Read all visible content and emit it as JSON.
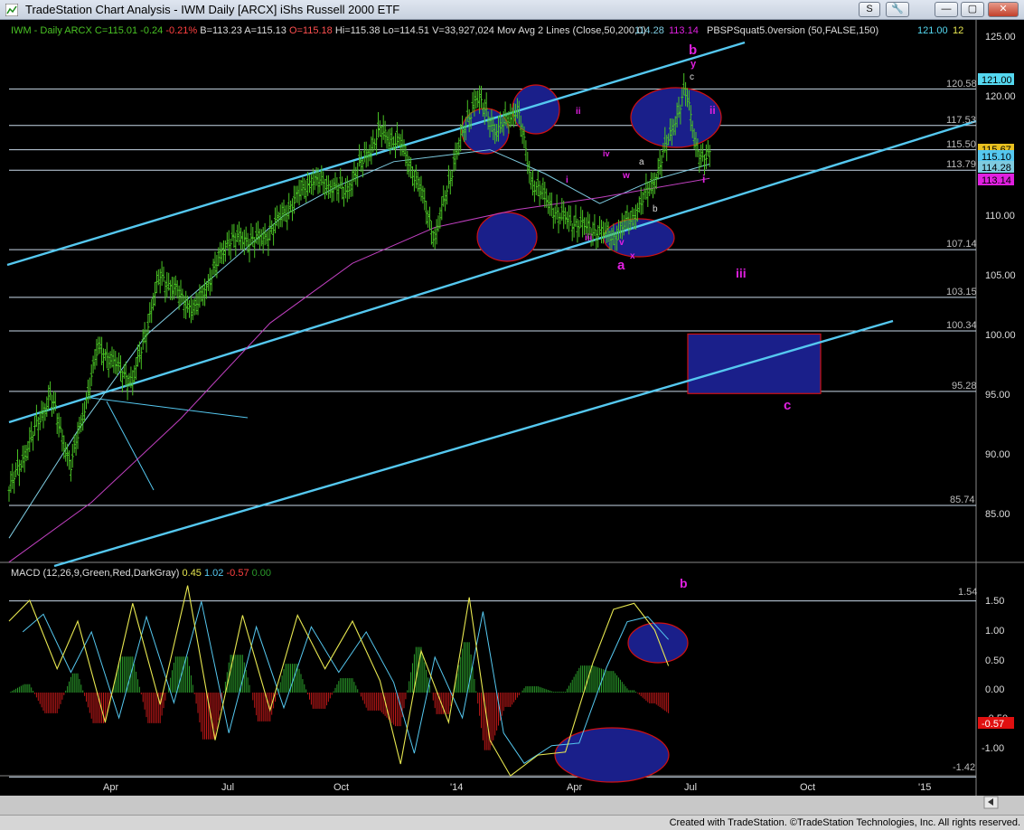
{
  "window": {
    "title": "TradeStation Chart Analysis - IWM Daily [ARCX] iShs Russell 2000 ETF",
    "buttons": [
      "S",
      "🔧",
      "—",
      "▢",
      "✕"
    ]
  },
  "footer": "Created with TradeStation. ©TradeStation Technologies, Inc. All rights reserved.",
  "colors": {
    "background": "#000000",
    "price_bars": "#49c224",
    "channel": "#55c8f0",
    "ma50": "#7ecbe0",
    "ma200": "#c040c0",
    "label_magenta": "#e020e0",
    "highlight": "#1a1f8a",
    "outline": "#d01010",
    "macd_line": "#e8e850",
    "signal_line": "#55c8f0",
    "hist_pos": "#2a9a2a",
    "hist_neg": "#c01818"
  },
  "price_panel": {
    "header": {
      "symbol": "IWM - Daily",
      "exchange": "ARCX",
      "last": "C=115.01",
      "change": "-0.24",
      "pct": "-0.21%",
      "bid": "B=113.23",
      "ask": "A=115.13",
      "open": "O=115.18",
      "high": "Hi=115.38",
      "low": "Lo=114.51",
      "volume": "V=33,927,024",
      "study1": "Mov Avg 2 Lines (Close,50,200,0)",
      "study1_v1": "114.28",
      "study1_v2": "113.14",
      "study2": "PBSPSquat5.0version (50,FALSE,150)",
      "study2_v1": "121.00",
      "study2_v2": "12"
    },
    "axis_labels": [
      "125.00",
      "120.00",
      "110.00",
      "105.00",
      "100.00",
      "95.00",
      "90.00",
      "85.00"
    ],
    "hlines": [
      "120.58",
      "117.53",
      "115.50",
      "113.79",
      "107.14",
      "103.15",
      "100.34",
      "95.28",
      "85.74"
    ],
    "value_tags": [
      {
        "text": "121.00",
        "bg": "#55d8f0",
        "fg": "#000"
      },
      {
        "text": "115.67",
        "bg": "#e8c020",
        "fg": "#000"
      },
      {
        "text": "115.10",
        "bg": "#55c8f0",
        "fg": "#000"
      },
      {
        "text": "114.28",
        "bg": "#7ecbe0",
        "fg": "#000"
      },
      {
        "text": "113.14",
        "bg": "#e020e0",
        "fg": "#000"
      }
    ],
    "wave_labels": [
      "b",
      "y",
      "c",
      "ii",
      "ii",
      "i",
      "iv",
      "w",
      "a",
      "b",
      "iii",
      "v",
      "x",
      "a",
      "i",
      "iii",
      "c"
    ]
  },
  "macd_panel": {
    "header": {
      "name": "MACD (12,26,9,Green,Red,DarkGray)",
      "v1": "0.45",
      "v2": "1.02",
      "v3": "-0.57",
      "v4": "0.00"
    },
    "axis_labels": [
      "1.50",
      "1.00",
      "0.50",
      "0.00",
      "-0.50",
      "-1.00"
    ],
    "hlines": [
      "1.54",
      "-1.42"
    ],
    "value_tag": "-0.57",
    "wave_label": "b"
  },
  "x_axis": [
    "Apr",
    "Jul",
    "Oct",
    "'14",
    "Apr",
    "Jul",
    "Oct",
    "'15"
  ],
  "chart_data": {
    "type": "ohlc",
    "symbol": "IWM",
    "interval": "daily",
    "ylim": [
      80,
      126
    ],
    "price_path": [
      [
        0,
        87
      ],
      [
        6,
        95
      ],
      [
        9,
        89
      ],
      [
        13,
        99
      ],
      [
        18,
        96
      ],
      [
        22,
        105
      ],
      [
        27,
        102
      ],
      [
        32,
        108
      ],
      [
        37,
        108
      ],
      [
        44,
        113
      ],
      [
        49,
        112
      ],
      [
        54,
        117
      ],
      [
        57,
        116
      ],
      [
        60,
        112
      ],
      [
        62,
        108
      ],
      [
        65,
        115
      ],
      [
        68,
        120
      ],
      [
        71,
        117
      ],
      [
        74,
        119
      ],
      [
        76,
        113
      ],
      [
        80,
        110
      ],
      [
        84,
        109
      ],
      [
        88,
        108.2
      ],
      [
        91,
        110
      ],
      [
        94,
        113
      ],
      [
        97,
        118
      ],
      [
        98.5,
        120.5
      ],
      [
        100,
        116
      ],
      [
        101,
        114.5
      ],
      [
        102,
        115
      ]
    ],
    "ma50_path": [
      [
        0,
        83
      ],
      [
        10,
        92
      ],
      [
        20,
        100
      ],
      [
        30,
        105
      ],
      [
        40,
        110
      ],
      [
        48,
        112.5
      ],
      [
        56,
        114.5
      ],
      [
        63,
        115
      ],
      [
        70,
        115.5
      ],
      [
        78,
        113.5
      ],
      [
        86,
        111
      ],
      [
        94,
        113
      ],
      [
        102,
        114.3
      ]
    ],
    "ma200_path": [
      [
        0,
        81
      ],
      [
        12,
        86
      ],
      [
        25,
        93
      ],
      [
        38,
        101
      ],
      [
        50,
        106
      ],
      [
        62,
        109
      ],
      [
        74,
        110.5
      ],
      [
        86,
        111.5
      ],
      [
        102,
        113.1
      ]
    ],
    "macd_path": [
      [
        0,
        1.2
      ],
      [
        3,
        1.55
      ],
      [
        7,
        0.4
      ],
      [
        10,
        1.2
      ],
      [
        14,
        -0.5
      ],
      [
        18,
        1.5
      ],
      [
        22,
        -0.2
      ],
      [
        26,
        1.8
      ],
      [
        30,
        -0.8
      ],
      [
        34,
        1.3
      ],
      [
        38,
        -0.3
      ],
      [
        42,
        1.3
      ],
      [
        46,
        0.4
      ],
      [
        50,
        1.2
      ],
      [
        54,
        0.2
      ],
      [
        57,
        -1.2
      ],
      [
        60,
        0.7
      ],
      [
        64,
        -0.5
      ],
      [
        67,
        1.6
      ],
      [
        70,
        -0.8
      ],
      [
        73,
        -1.4
      ],
      [
        77,
        -1.05
      ],
      [
        81,
        -1.0
      ],
      [
        85,
        0.5
      ],
      [
        88,
        1.4
      ],
      [
        91,
        1.5
      ],
      [
        94,
        1.05
      ],
      [
        96,
        0.45
      ]
    ]
  }
}
